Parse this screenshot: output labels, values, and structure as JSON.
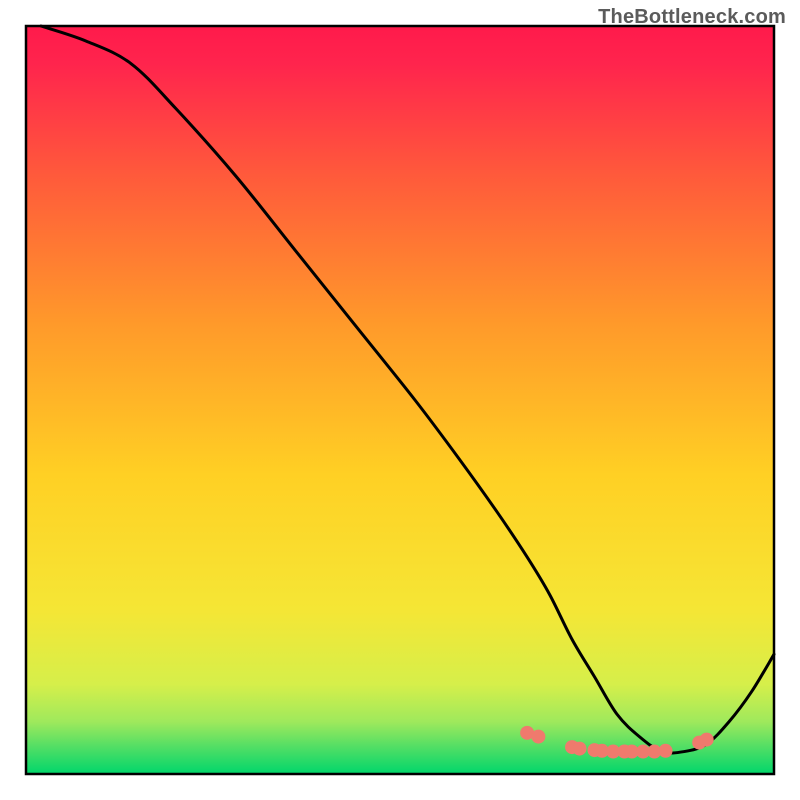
{
  "watermark": {
    "text": "TheBottleneck.com"
  },
  "chart_data": {
    "type": "line",
    "title": "",
    "xlabel": "",
    "ylabel": "",
    "xlim": [
      0,
      100
    ],
    "ylim": [
      0,
      100
    ],
    "grid": false,
    "legend": false,
    "background_gradient": {
      "top_color": "#ff1a4b",
      "mid_color": "#ffd500",
      "bottom_color": "#00d66b"
    },
    "series": [
      {
        "name": "bottleneck-curve",
        "color": "#000000",
        "x": [
          2,
          8,
          14,
          20,
          28,
          36,
          44,
          52,
          58,
          63,
          67,
          70,
          73,
          76,
          79,
          82,
          85,
          88,
          91,
          94,
          97,
          100
        ],
        "y": [
          100,
          98,
          95,
          89,
          80,
          70,
          60,
          50,
          42,
          35,
          29,
          24,
          18,
          13,
          8,
          5,
          3,
          3,
          4,
          7,
          11,
          16
        ]
      }
    ],
    "highlight_points": {
      "color": "#ef7a6d",
      "radius": 7,
      "x": [
        67,
        68.5,
        73,
        74,
        76,
        77,
        78.5,
        80,
        81,
        82.5,
        84,
        85.5,
        90,
        91
      ],
      "y": [
        5.5,
        5.0,
        3.6,
        3.4,
        3.2,
        3.1,
        3.0,
        3.0,
        3.0,
        3.0,
        3.0,
        3.1,
        4.2,
        4.6
      ]
    }
  }
}
